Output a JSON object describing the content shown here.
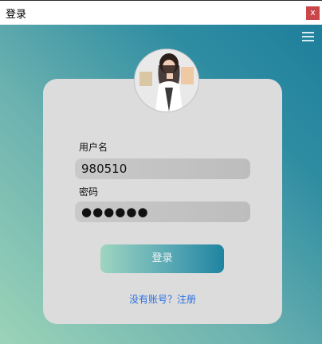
{
  "window": {
    "title": "登录",
    "close_label": "x"
  },
  "login": {
    "username_label": "用户名",
    "username_value": "980510",
    "password_label": "密码",
    "password_value": "●●●●●●",
    "login_button": "登录",
    "register_link": "没有账号？注册"
  },
  "colors": {
    "close_button": "#c9474b",
    "card_background": "#dcdcdc",
    "link": "#2a6fe0",
    "gradient_start": "#9bd3b8",
    "gradient_end": "#1e7f9c"
  },
  "icons": [
    "menu-icon",
    "avatar"
  ]
}
